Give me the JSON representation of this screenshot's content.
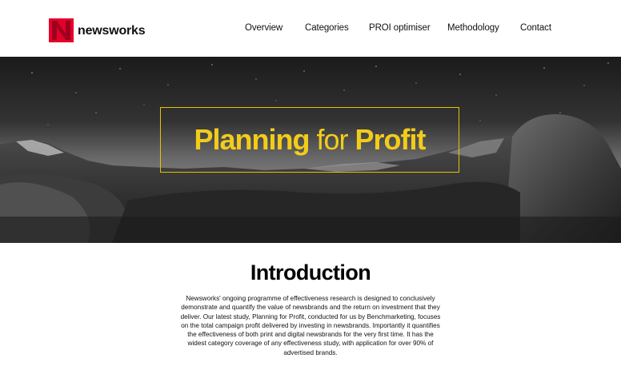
{
  "brand": {
    "logo_letter": "N",
    "name": "newsworks",
    "accent_color": "#e4002b"
  },
  "nav": {
    "items": [
      {
        "label": "Overview"
      },
      {
        "label": "Categories"
      },
      {
        "label": "PROI optimiser"
      },
      {
        "label": "Methodology"
      },
      {
        "label": "Contact"
      }
    ]
  },
  "hero": {
    "title_part1": "Planning",
    "title_part2": "for",
    "title_part3": "Profit",
    "title_color": "#f2cc1a",
    "background": "night-mountain-landscape-image"
  },
  "intro": {
    "heading": "Introduction",
    "body": "Newsworks' ongoing programme of effectiveness research is designed to conclusively demonstrate and quantify the value of newsbrands and the return on investment that they deliver. Our latest study, Planning for Profit, conducted for us by Benchmarketing, focuses on the total campaign profit delivered by investing in newsbrands.  Importantly it quantifies the effectiveness of both print and digital newsbrands for the very first time. It has the widest category coverage of any effectiveness study, with application for over 90% of advertised brands."
  }
}
